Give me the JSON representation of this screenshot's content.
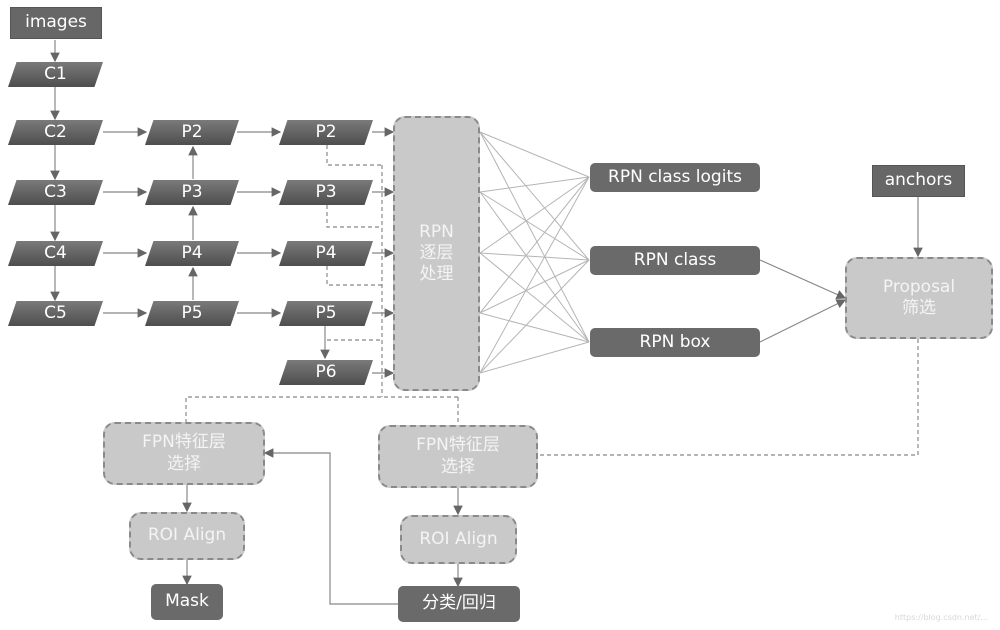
{
  "nodes": {
    "images": "images",
    "c1": "C1",
    "c2": "C2",
    "c3": "C3",
    "c4": "C4",
    "c5": "C5",
    "p2a": "P2",
    "p3a": "P3",
    "p4a": "P4",
    "p5a": "P5",
    "p2b": "P2",
    "p3b": "P3",
    "p4b": "P4",
    "p5b": "P5",
    "p6": "P6",
    "rpn_stage": "RPN\n逐层\n处理",
    "rpn_class_logits": "RPN class logits",
    "rpn_class": "RPN class",
    "rpn_box": "RPN box",
    "anchors": "anchors",
    "proposal": "Proposal\n筛选",
    "fpn_select_left": "FPN特征层\n选择",
    "fpn_select_right": "FPN特征层\n选择",
    "roi_align_left": "ROI Align",
    "roi_align_right": "ROI Align",
    "mask": "Mask",
    "cls_reg": "分类/回归"
  },
  "watermark": "https://blog.csdn.net/..."
}
